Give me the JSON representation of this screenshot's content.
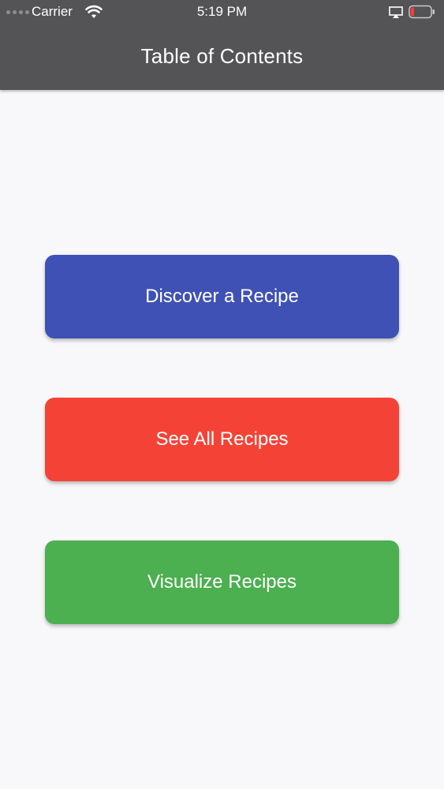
{
  "status_bar": {
    "carrier": "Carrier",
    "time": "5:19 PM",
    "battery_level": 0.1
  },
  "header": {
    "title": "Table of Contents",
    "background": "#545356"
  },
  "menu": [
    {
      "label": "Discover a Recipe",
      "color": "#3f51b5"
    },
    {
      "label": "See All Recipes",
      "color": "#f44336"
    },
    {
      "label": "Visualize Recipes",
      "color": "#4caf50"
    }
  ]
}
